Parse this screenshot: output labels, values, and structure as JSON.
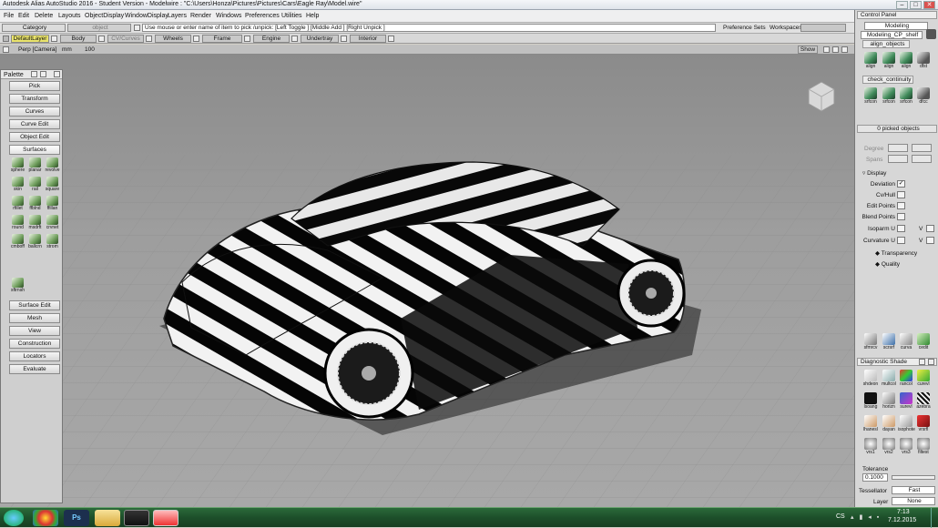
{
  "app": {
    "title": "Autodesk Alias AutoStudio 2016  -  Student Version   -  Modelwire : \"C:\\Users\\Honza\\Pictures\\Pictures\\Cars\\Eagle Ray\\Model.wire\"",
    "window_controls": [
      "–",
      "□",
      "✕"
    ]
  },
  "menu": [
    "File",
    "Edit",
    "Delete",
    "Layouts",
    "ObjectDisplay",
    "WindowDisplay",
    "Layers",
    "Render",
    "Windows",
    "Preferences",
    "Utilities",
    "Help"
  ],
  "toolbar": {
    "category_label": "Category",
    "object_label": "object",
    "prompt": "Use mouse or enter name of item to pick /unpick: [Left Toggle ] [Middle Add ] [Right Unpick ]",
    "preference_sets": "Preference Sets",
    "workspaces": "Workspaces"
  },
  "layers": [
    "DefaultLayer",
    "Body",
    "CV/Curves",
    "Wheels",
    "Frame",
    "Engine",
    "Undertray",
    "Interior"
  ],
  "viewport": {
    "camera_label": "Perp [Camera]",
    "unit": "mm",
    "zoom": "100",
    "show_button": "Show"
  },
  "palette": {
    "title": "Palette",
    "buttons_top": [
      "Pick",
      "Transform",
      "Curves",
      "Curve Edit",
      "Object Edit",
      "Surfaces"
    ],
    "surface_tools": [
      "sphere",
      "planar",
      "revolve",
      "skin",
      "rail",
      "square",
      "rfillet",
      "ffblnd",
      "ffillan",
      "round",
      "msdrft",
      "crvnet",
      "cmboff",
      "ballcrn",
      "strom",
      "sftrnsh"
    ],
    "buttons_bottom": [
      "Surface Edit",
      "Mesh",
      "View",
      "Construction",
      "Locators",
      "Evaluate"
    ]
  },
  "control_panel": {
    "title": "Control Panel",
    "mode": "Modeling",
    "shelf": "Modeling_CP_shelf",
    "tab_align": "align_objects",
    "align_tools": [
      "align",
      "align",
      "align",
      "dfst"
    ],
    "tab_check": "check_continuity",
    "check_tools": [
      "srfcon",
      "srfcon",
      "srfcon",
      "dfcc"
    ],
    "picked": "0 picked objects",
    "degree_label": "Degree",
    "spans_label": "Spans",
    "display_label": "Display",
    "display_rows": [
      {
        "label": "Deviation",
        "checked": true
      },
      {
        "label": "Cv/Hull",
        "checked": false
      },
      {
        "label": "Edit Points",
        "checked": false
      },
      {
        "label": "Blend Points",
        "checked": false
      },
      {
        "label": "Isoparm U",
        "checked": false,
        "v": true
      },
      {
        "label": "Curvature U",
        "checked": false,
        "v": true
      }
    ],
    "v_label": "V",
    "transparency": "Transparency",
    "quality": "Quality",
    "bottom_tools": [
      "sfmrcv",
      "scrsrf",
      "curva",
      "cedit"
    ]
  },
  "diagnostic": {
    "title": "Diagnostic Shade",
    "tools": [
      "shdeon",
      "multcol",
      "rancol",
      "curevl",
      "lsoang",
      "horizn",
      "surevl",
      "azebra",
      "lhanesl",
      "dayan",
      "isophote",
      "vrsrfl",
      "vrs1",
      "vrs2",
      "vrs3",
      "filtest"
    ],
    "tolerance_label": "Tolerance",
    "tolerance_value": "0.1000",
    "tessellator_label": "Tessellator",
    "tessellator_value": "Fast",
    "layer_label": "Layer",
    "layer_value": "None"
  },
  "taskbar": {
    "time": "7:13",
    "date": "7.12.2015",
    "language": "CS"
  }
}
